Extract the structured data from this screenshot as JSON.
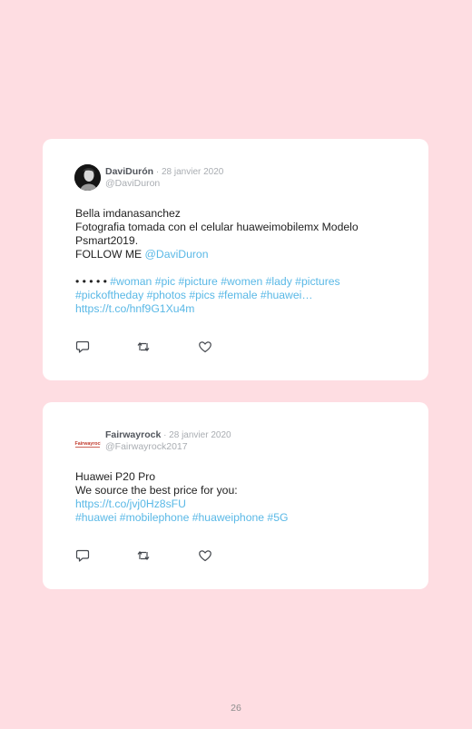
{
  "tweets": [
    {
      "author_name": "DaviDurón",
      "date": " · 28 janvier 2020",
      "handle": "@DaviDuron",
      "lines": {
        "l1": "Bella imdanasanchez",
        "l2": "Fotografia tomada con el celular huaweimobilemx Modelo",
        "l3": "Psmart2019.",
        "l4_prefix": "FOLLOW ME ",
        "l4_link": "@DaviDuron",
        "l5_prefix": "• • • • • ",
        "l5_tags": "#woman #pic #picture #women #lady #pictures",
        "l6_tags": "#pickoftheday #photos #pics #female #huawei…",
        "l7_link": "https://t.co/hnf9G1Xu4m"
      }
    },
    {
      "author_name": "Fairwayrock",
      "date": " · 28 janvier 2020",
      "handle": "@Fairwayrock2017",
      "avatar_logo_text": "Fairwayrock",
      "lines": {
        "l1": "Huawei P20 Pro",
        "l2": "We source the best price for you:",
        "l3_link": "https://t.co/jvj0Hz8sFU",
        "l4_tags": "#huawei #mobilephone #huaweiphone #5G"
      }
    }
  ],
  "icons": {
    "reply": "reply-icon",
    "retweet": "retweet-icon",
    "like": "heart-icon"
  },
  "colors": {
    "background": "#fedde2",
    "card": "#ffffff",
    "link": "#59b8e6",
    "muted": "#a9adb2"
  },
  "page_number": "26"
}
